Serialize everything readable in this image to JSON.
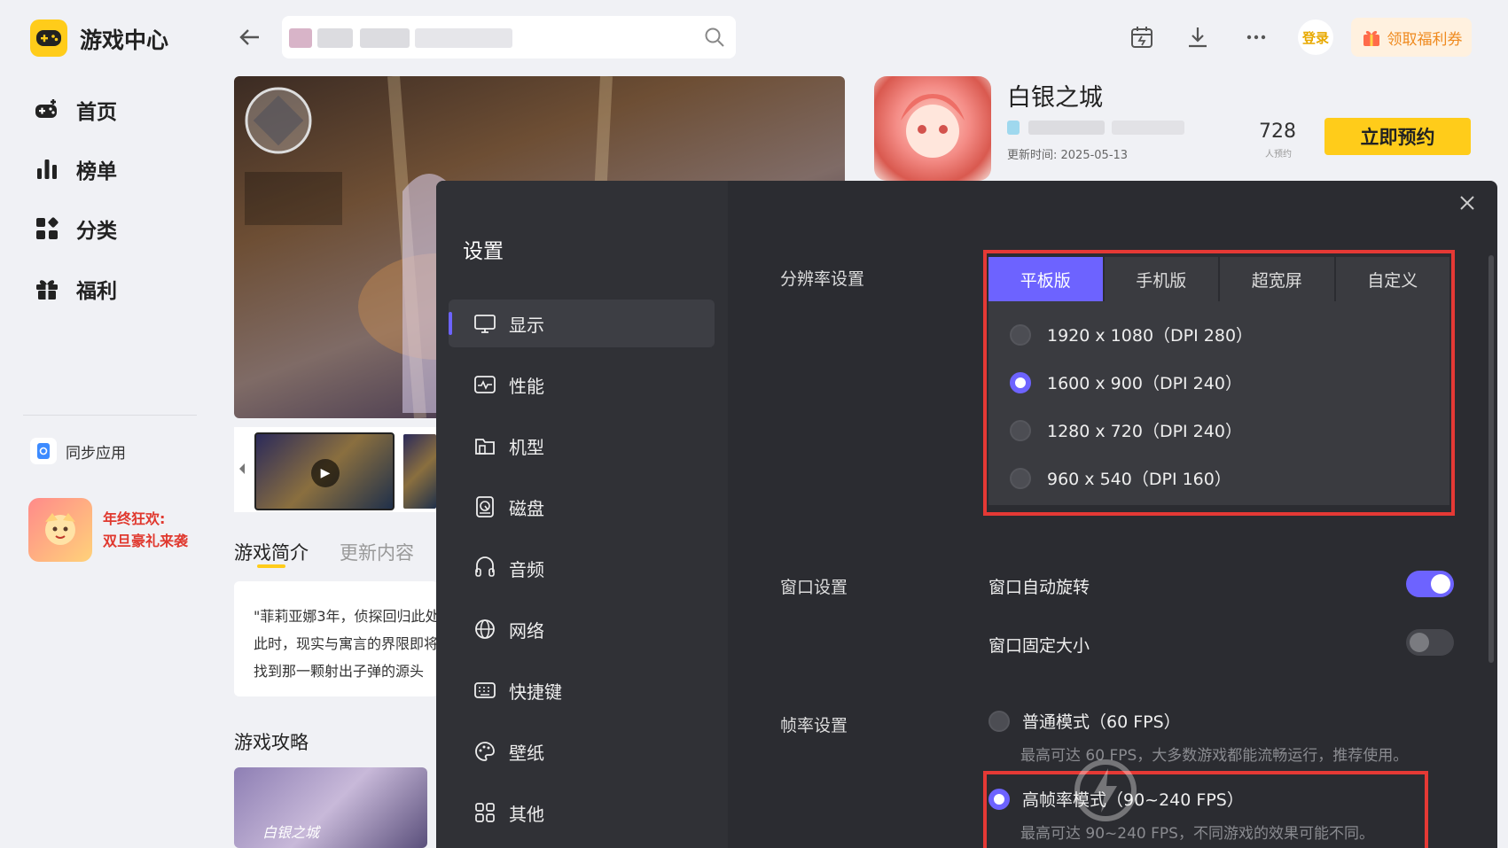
{
  "app": {
    "title": "游戏中心"
  },
  "sidebar": {
    "items": [
      {
        "label": "首页",
        "icon": "gamepad-icon"
      },
      {
        "label": "榜单",
        "icon": "bar-chart-icon"
      },
      {
        "label": "分类",
        "icon": "category-icon"
      },
      {
        "label": "福利",
        "icon": "gift-icon"
      }
    ],
    "sync_label": "同步应用",
    "promo_line1": "年终狂欢:",
    "promo_line2": "双旦豪礼来袭"
  },
  "topbar": {
    "login_label": "登录",
    "welfare_label": "领取福利券"
  },
  "game": {
    "name": "白银之城",
    "update_time": "更新时间: 2025-05-13",
    "reservation_count": "728",
    "reservation_unit": "人预约",
    "reserve_button": "立即预约",
    "tabs": [
      "游戏简介",
      "更新内容"
    ],
    "intro_lines": [
      "\"菲莉亚娜3年，侦探回归此处",
      "此时，现实与寓言的界限即将",
      "找到那一颗射出子弹的源头"
    ],
    "guide_title": "游戏攻略",
    "guide_image_text": "白银之城"
  },
  "settings": {
    "title": "设置",
    "nav": [
      {
        "label": "显示",
        "icon": "monitor-icon"
      },
      {
        "label": "性能",
        "icon": "performance-icon"
      },
      {
        "label": "机型",
        "icon": "device-icon"
      },
      {
        "label": "磁盘",
        "icon": "disk-icon"
      },
      {
        "label": "音频",
        "icon": "audio-icon"
      },
      {
        "label": "网络",
        "icon": "globe-icon"
      },
      {
        "label": "快捷键",
        "icon": "keyboard-icon"
      },
      {
        "label": "壁纸",
        "icon": "palette-icon"
      },
      {
        "label": "其他",
        "icon": "grid-icon"
      }
    ],
    "resolution": {
      "label": "分辨率设置",
      "tabs": [
        "平板版",
        "手机版",
        "超宽屏",
        "自定义"
      ],
      "active_tab": "平板版",
      "options": [
        "1920 x 1080（DPI 280）",
        "1600 x 900（DPI 240）",
        "1280 x 720（DPI 240）",
        "960 x 540（DPI 160）"
      ],
      "selected": "1600 x 900（DPI 240）"
    },
    "window": {
      "label": "窗口设置",
      "auto_rotate": "窗口自动旋转",
      "auto_rotate_on": true,
      "fixed_size": "窗口固定大小",
      "fixed_size_on": false
    },
    "fps": {
      "label": "帧率设置",
      "normal": "普通模式（60 FPS）",
      "normal_desc": "最高可达 60 FPS，大多数游戏都能流畅运行，推荐使用。",
      "high": "高帧率模式（90~240 FPS）",
      "high_desc": "最高可达 90~240 FPS，不同游戏的效果可能不同。",
      "selected": "high"
    },
    "watermark": "雷电模拟器"
  },
  "colors": {
    "accent": "#6d63ff",
    "brand_yellow": "#ffcc1a",
    "highlight_red": "#e53935"
  }
}
